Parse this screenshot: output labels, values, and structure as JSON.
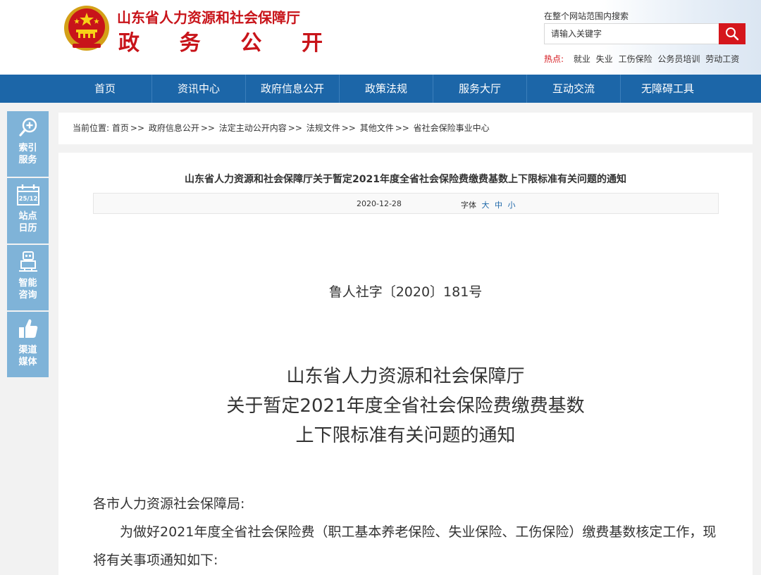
{
  "header": {
    "site_name": "山东省人力资源和社会保障厅",
    "site_sub_chars": [
      "政",
      "务",
      "公",
      "开"
    ],
    "search_hint": "在整个网站范围内搜索",
    "search_placeholder": "请输入关键字",
    "hot_label": "热点:",
    "hot_links": [
      "就业",
      "失业",
      "工伤保险",
      "公务员培训",
      "劳动工资"
    ]
  },
  "nav": {
    "items": [
      "首页",
      "资讯中心",
      "政府信息公开",
      "政策法规",
      "服务大厅",
      "互动交流",
      "无障碍工具"
    ]
  },
  "sidebar": {
    "items": [
      {
        "label": "索引服务",
        "icon": "zoom-in-icon"
      },
      {
        "label": "站点日历",
        "icon": "calendar-icon",
        "date_badge": "25/12"
      },
      {
        "label": "智能咨询",
        "icon": "robot-icon"
      },
      {
        "label": "渠道媒体",
        "icon": "thumbs-up-icon"
      }
    ]
  },
  "breadcrumb": {
    "prefix": "当前位置:",
    "items": [
      "首页",
      "政府信息公开",
      "法定主动公开内容",
      "法规文件",
      "其他文件",
      "省社会保险事业中心"
    ],
    "separator": ">>"
  },
  "article": {
    "title": "山东省人力资源和社会保障厅关于暂定2021年度全省社会保险费缴费基数上下限标准有关问题的通知",
    "date": "2020-12-28",
    "font_label": "字体",
    "font_sizes": [
      "大",
      "中",
      "小"
    ],
    "doc_number": "鲁人社字〔2020〕181号",
    "doc_title_lines": [
      "山东省人力资源和社会保障厅",
      "关于暂定2021年度全省社会保险费缴费基数",
      "上下限标准有关问题的通知"
    ],
    "salutation": "各市人力资源社会保障局:",
    "body": "为做好2021年度全省社会保险费（职工基本养老保险、失业保险、工伤保险）缴费基数核定工作，现将有关事项通知如下:"
  },
  "colors": {
    "brand_red": "#c8141a",
    "nav_blue": "#1c66a8",
    "sidebar_blue": "#7fb3d8",
    "search_button_red": "#d5161c"
  }
}
